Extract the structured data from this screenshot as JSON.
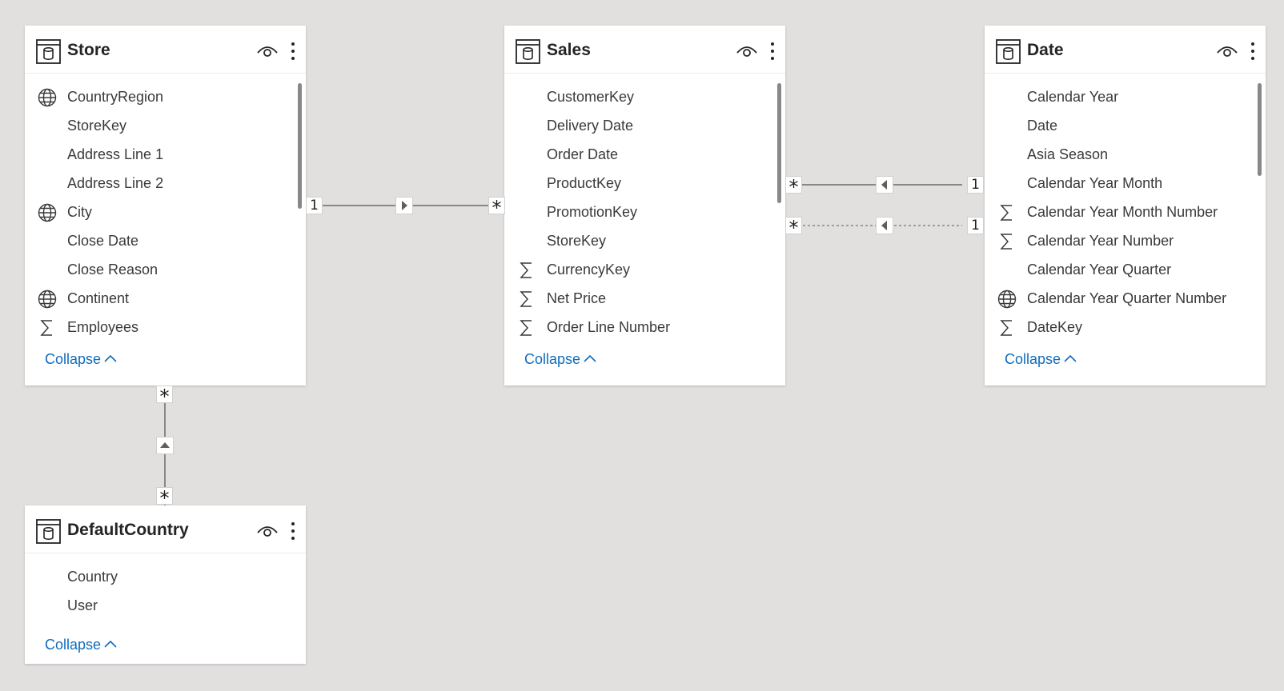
{
  "tables": {
    "store": {
      "title": "Store",
      "fields": [
        {
          "label": "CountryRegion",
          "icon": "globe-icon"
        },
        {
          "label": "StoreKey",
          "icon": ""
        },
        {
          "label": "Address Line 1",
          "icon": ""
        },
        {
          "label": "Address Line 2",
          "icon": ""
        },
        {
          "label": "City",
          "icon": "globe-icon"
        },
        {
          "label": "Close Date",
          "icon": ""
        },
        {
          "label": "Close Reason",
          "icon": ""
        },
        {
          "label": "Continent",
          "icon": "globe-icon"
        },
        {
          "label": "Employees",
          "icon": "sigma-icon"
        }
      ],
      "collapse_label": "Collapse"
    },
    "sales": {
      "title": "Sales",
      "fields": [
        {
          "label": "CustomerKey",
          "icon": ""
        },
        {
          "label": "Delivery Date",
          "icon": ""
        },
        {
          "label": "Order Date",
          "icon": ""
        },
        {
          "label": "ProductKey",
          "icon": ""
        },
        {
          "label": "PromotionKey",
          "icon": ""
        },
        {
          "label": "StoreKey",
          "icon": ""
        },
        {
          "label": "CurrencyKey",
          "icon": "sigma-icon"
        },
        {
          "label": "Net Price",
          "icon": "sigma-icon"
        },
        {
          "label": "Order Line Number",
          "icon": "sigma-icon"
        }
      ],
      "collapse_label": "Collapse"
    },
    "date": {
      "title": "Date",
      "fields": [
        {
          "label": "Calendar Year",
          "icon": ""
        },
        {
          "label": "Date",
          "icon": ""
        },
        {
          "label": "Asia Season",
          "icon": ""
        },
        {
          "label": "Calendar Year Month",
          "icon": ""
        },
        {
          "label": "Calendar Year Month Number",
          "icon": "sigma-icon"
        },
        {
          "label": "Calendar Year Number",
          "icon": "sigma-icon"
        },
        {
          "label": "Calendar Year Quarter",
          "icon": ""
        },
        {
          "label": "Calendar Year Quarter Number",
          "icon": "globe-icon"
        },
        {
          "label": "DateKey",
          "icon": "sigma-icon"
        }
      ],
      "collapse_label": "Collapse"
    },
    "defaultcountry": {
      "title": "DefaultCountry",
      "fields": [
        {
          "label": "Country",
          "icon": ""
        },
        {
          "label": "User",
          "icon": ""
        }
      ],
      "collapse_label": "Collapse"
    }
  },
  "relationships": {
    "store_sales": {
      "from_card": "1",
      "to_card": "*",
      "active": true
    },
    "sales_date": {
      "from_card": "*",
      "to_card": "1",
      "active": true
    },
    "sales_date_inactive": {
      "from_card": "*",
      "to_card": "1",
      "active": false
    },
    "store_defaultcountry": {
      "from_card": "*",
      "to_card": "*",
      "active": true
    }
  },
  "colors": {
    "canvas": "#e1e0df",
    "card": "#ffffff",
    "link": "#0f6cbd",
    "relationship_line": "#8a8886"
  }
}
